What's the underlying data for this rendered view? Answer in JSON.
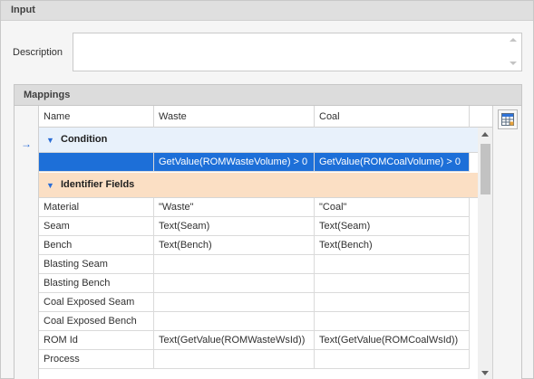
{
  "input_group": {
    "title": "Input"
  },
  "description": {
    "label": "Description",
    "value": ""
  },
  "mappings": {
    "title": "Mappings",
    "columns": [
      "Name",
      "Waste",
      "Coal"
    ],
    "condition_group": {
      "label": "Condition",
      "row": {
        "name": "",
        "waste": "GetValue(ROMWasteVolume) > 0",
        "coal": "GetValue(ROMCoalVolume) > 0"
      }
    },
    "identifier_group": {
      "label": "Identifier Fields"
    },
    "rows": [
      {
        "name": "Material",
        "waste": "\"Waste\"",
        "coal": "\"Coal\""
      },
      {
        "name": "Seam",
        "waste": "Text(Seam)",
        "coal": "Text(Seam)"
      },
      {
        "name": "Bench",
        "waste": "Text(Bench)",
        "coal": "Text(Bench)"
      },
      {
        "name": "Blasting Seam",
        "waste": "",
        "coal": ""
      },
      {
        "name": "Blasting Bench",
        "waste": "",
        "coal": ""
      },
      {
        "name": "Coal Exposed Seam",
        "waste": "",
        "coal": ""
      },
      {
        "name": "Coal Exposed Bench",
        "waste": "",
        "coal": ""
      },
      {
        "name": "ROM Id",
        "waste": "Text(GetValue(ROMWasteWsId))",
        "coal": "Text(GetValue(ROMCoalWsId))"
      },
      {
        "name": "Process",
        "waste": "",
        "coal": ""
      }
    ]
  },
  "icons": {
    "row_indicator": "arrow-right-icon",
    "side_button": "table-settings-icon"
  },
  "colors": {
    "selection": "#1d6fd8",
    "condition_band": "#e8f1fb",
    "identifier_band": "#fbdfc4"
  }
}
